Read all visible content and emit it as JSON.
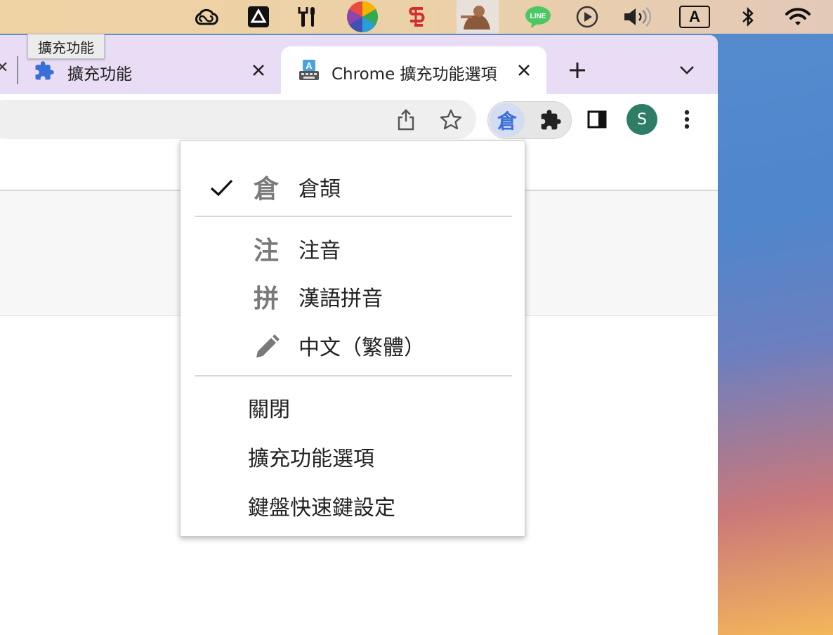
{
  "menubar": {
    "icons": [
      "creative-cloud-icon",
      "drive-icon",
      "tools-icon",
      "color-picker-icon",
      "app-icon",
      "user-icon",
      "line-app-icon",
      "play-icon",
      "volume-icon",
      "input-method-icon",
      "bluetooth-icon",
      "wifi-icon"
    ],
    "line_label": "LINE",
    "input_label": "A"
  },
  "tooltip": {
    "text": "擴充功能"
  },
  "tabs": [
    {
      "title": "擴充功能",
      "icon": "puzzle-icon",
      "active": false
    },
    {
      "title": "Chrome 擴充功能選項",
      "icon": "keyboard-ime-icon",
      "active": true
    }
  ],
  "toolbar": {
    "active_extension_label": "倉",
    "avatar_initial": "S"
  },
  "menu": {
    "input_modes": [
      {
        "glyph": "倉",
        "label": "倉頡",
        "checked": true
      },
      {
        "glyph": "注",
        "label": "注音",
        "checked": false
      },
      {
        "glyph": "拼",
        "label": "漢語拼音",
        "checked": false
      },
      {
        "glyph": "pencil",
        "label": "中文（繁體）",
        "checked": false
      }
    ],
    "actions": [
      {
        "label": "關閉"
      },
      {
        "label": "擴充功能選項"
      },
      {
        "label": "鍵盤快速鍵設定"
      }
    ]
  },
  "colors": {
    "tabstrip": "#e9dcf5",
    "accent_blue": "#3b6fd8",
    "avatar": "#2e7d67"
  }
}
